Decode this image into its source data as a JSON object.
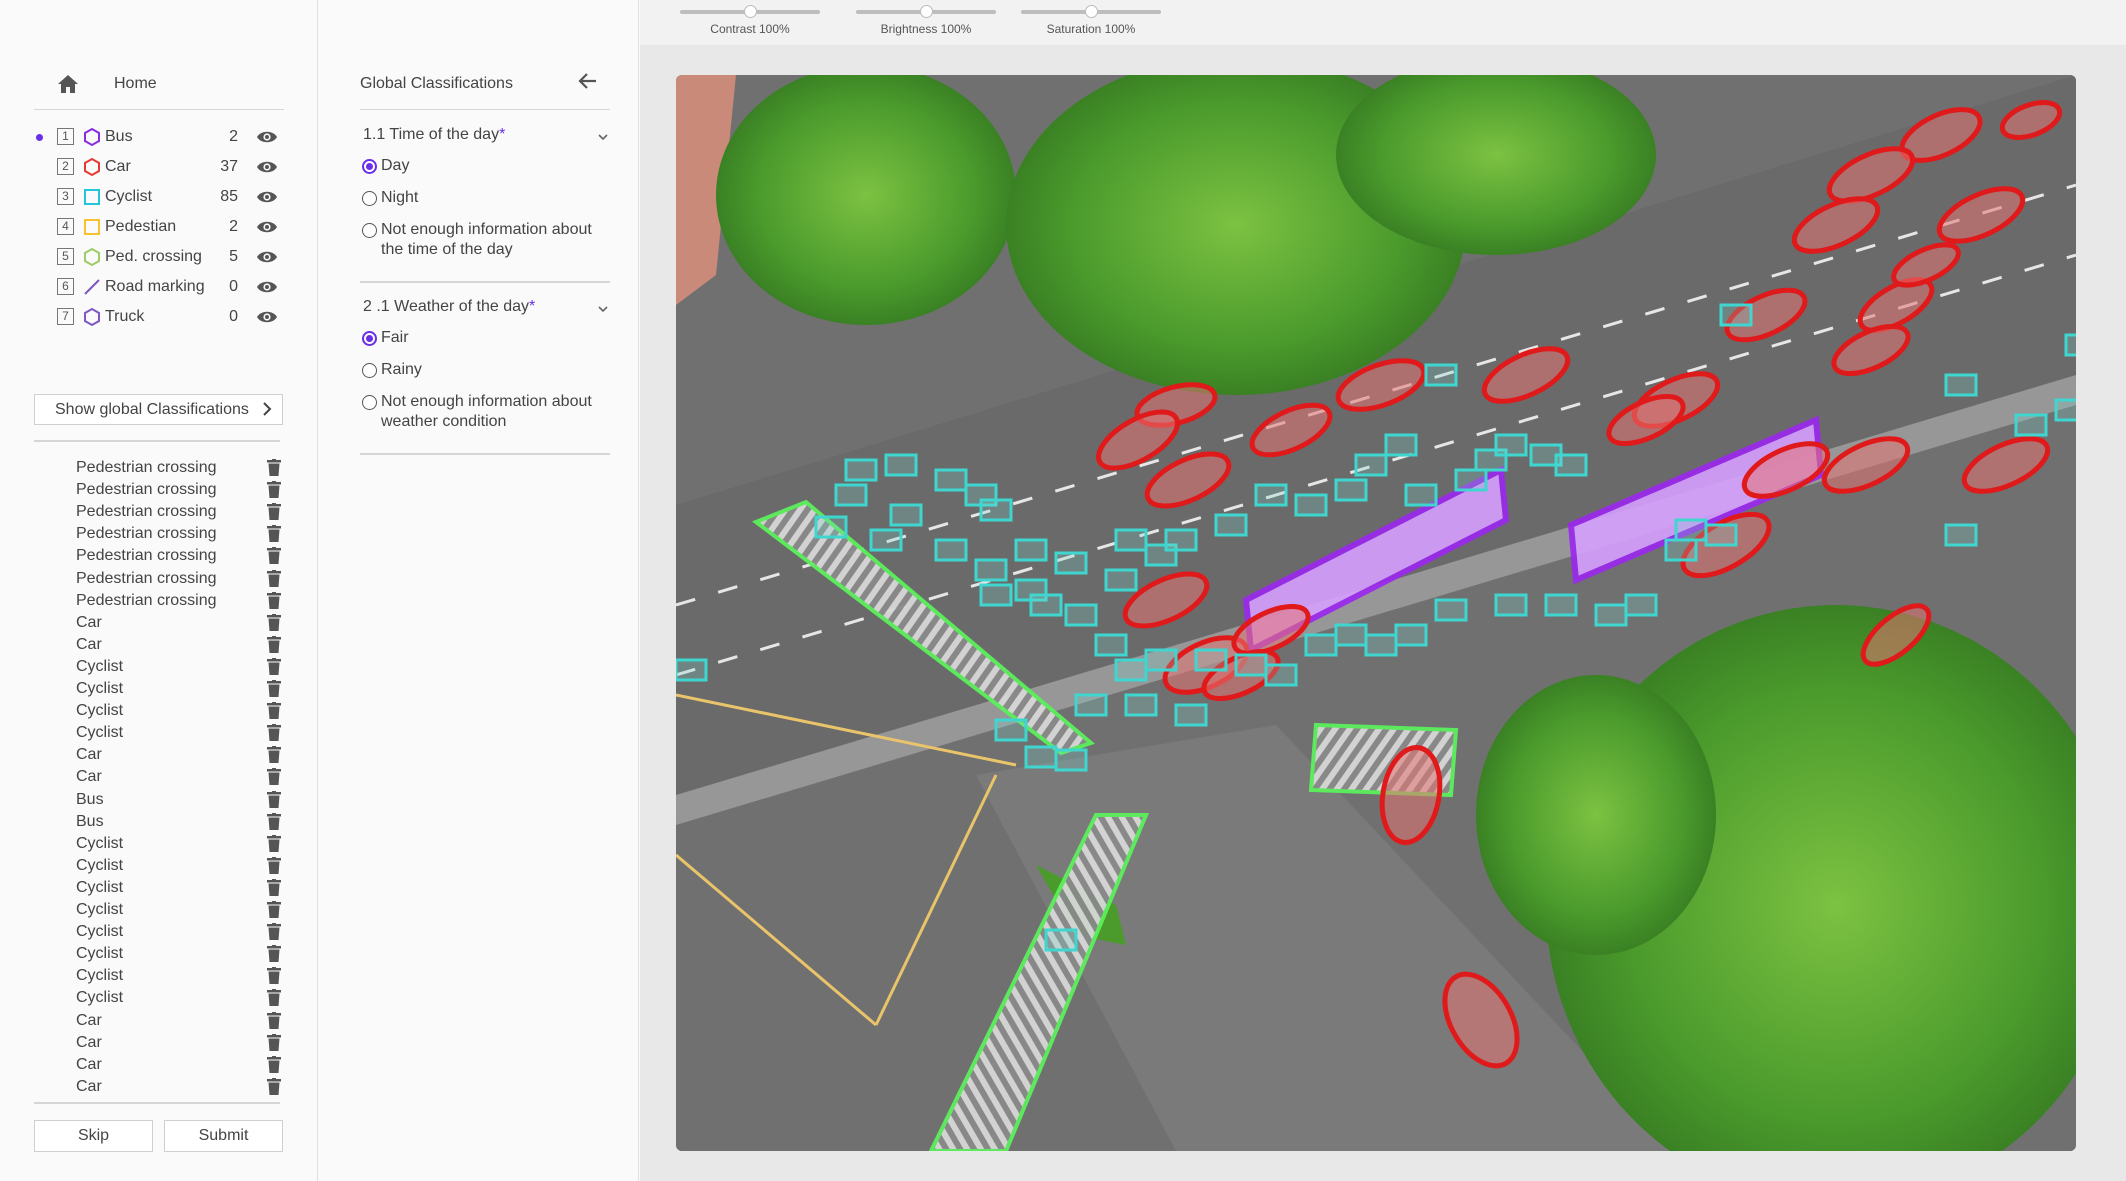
{
  "home": {
    "label": "Home"
  },
  "classes": [
    {
      "key": "1",
      "name": "Bus",
      "count": "2",
      "color": "#8a2be2",
      "shape": "polygon",
      "active": true
    },
    {
      "key": "2",
      "name": "Car",
      "count": "37",
      "color": "#e53935",
      "shape": "polygon",
      "active": false
    },
    {
      "key": "3",
      "name": "Cyclist",
      "count": "85",
      "color": "#26c6da",
      "shape": "box",
      "active": false
    },
    {
      "key": "4",
      "name": "Pedestian",
      "count": "2",
      "color": "#fbc02d",
      "shape": "box",
      "active": false
    },
    {
      "key": "5",
      "name": "Ped. crossing",
      "count": "5",
      "color": "#9ccc65",
      "shape": "polygon",
      "active": false
    },
    {
      "key": "6",
      "name": "Road marking",
      "count": "0",
      "color": "#7e57c2",
      "shape": "line",
      "active": false
    },
    {
      "key": "7",
      "name": "Truck",
      "count": "0",
      "color": "#7e57c2",
      "shape": "polygon",
      "active": false
    }
  ],
  "show_global_button": "Show global Classifications",
  "annotations": [
    "Pedestrian crossing",
    "Pedestrian crossing",
    "Pedestrian crossing",
    "Pedestrian crossing",
    "Pedestrian crossing",
    "Pedestrian crossing",
    "Pedestrian crossing",
    "Car",
    "Car",
    "Cyclist",
    "Cyclist",
    "Cyclist",
    "Cyclist",
    "Car",
    "Car",
    "Bus",
    "Bus",
    "Cyclist",
    "Cyclist",
    "Cyclist",
    "Cyclist",
    "Cyclist",
    "Cyclist",
    "Cyclist",
    "Cyclist",
    "Car",
    "Car",
    "Car",
    "Car"
  ],
  "buttons": {
    "skip": "Skip",
    "submit": "Submit"
  },
  "global_classifications": {
    "title": "Global Classifications",
    "questions": [
      {
        "title": "1.1 Time of the day",
        "required_mark": "*",
        "options": [
          {
            "label": "Day",
            "checked": true
          },
          {
            "label": "Night",
            "checked": false
          },
          {
            "label": "Not enough information about the time of the day",
            "checked": false
          }
        ]
      },
      {
        "title": "2 .1 Weather of the day",
        "required_mark": "*",
        "options": [
          {
            "label": "Fair",
            "checked": true
          },
          {
            "label": "Rainy",
            "checked": false
          },
          {
            "label": "Not enough information about weather condition",
            "checked": false
          }
        ]
      }
    ]
  },
  "image_adjustments": [
    {
      "label": "Contrast 100%",
      "value": 100
    },
    {
      "label": "Brightness 100%",
      "value": 100
    },
    {
      "label": "Saturation 100%",
      "value": 100
    }
  ],
  "colors": {
    "accent": "#6a2ee8",
    "bus_outline": "#9c27f0",
    "car_outline": "#e0191a",
    "cyclist_box": "#3fd6d0",
    "crossing_outline": "#5cf05c"
  }
}
